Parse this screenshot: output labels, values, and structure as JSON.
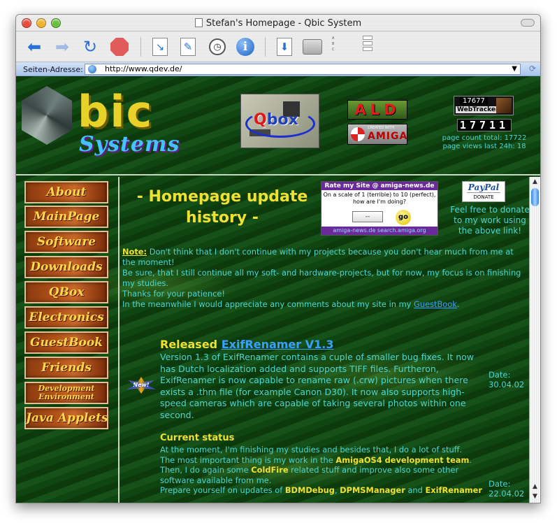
{
  "window": {
    "title": "Stefan's Homepage - Qbic System"
  },
  "address": {
    "label": "Seiten-Adresse:",
    "url": "http://www.qdev.de/"
  },
  "toolbar": {
    "back_icon": "back-arrow-icon",
    "forward_icon": "forward-arrow-icon",
    "reload_icon": "reload-icon",
    "stop_icon": "stop-icon",
    "text_size": [
      "A",
      "B",
      "C"
    ]
  },
  "banner": {
    "logo_main": "bic",
    "logo_sub": "Systems",
    "qbox_label_q": "Q",
    "qbox_label_rest": "box",
    "ald_text": "ALD",
    "amiga_created": "CREATED WITH",
    "amiga_text": "AMIGA",
    "tracker_number": "17677",
    "tracker_label": "WebTracker",
    "counter": "17711",
    "stats_line1": "page count total: 17722",
    "stats_line2": "page views last 24h: 18"
  },
  "nav": {
    "items": [
      "About",
      "MainPage",
      "Software",
      "Downloads",
      "QBox",
      "Electronics",
      "GuestBook",
      "Friends",
      "Development Environment",
      "Java Applets"
    ]
  },
  "content": {
    "title_line1": "- Homepage update",
    "title_line2": "history -",
    "rate": {
      "header": "Rate my Site @ amiga-news.de",
      "question": "On a scale of 1 (terrible) to 10 (perfect), how are I'm doing?",
      "select_value": "--",
      "go": "go",
      "footer": "amiga-news.de  search.amiga.org"
    },
    "paypal": {
      "logo": "PayPal",
      "donate": "DONATE"
    },
    "donate_text": "Feel free to donate to my work using the above link!",
    "note": {
      "label": "Note:",
      "line1": " Don't think that I don't continue with my projects because you don't hear much from me at the moment!",
      "line2": "Be sure, that I still continue all my soft- and hardware-projects, but for now, my focus is on finishing my studies.",
      "line3": "Thanks for your patience!",
      "line4_pre": "In the meanwhile I would appreciate any comments about my site in my ",
      "guestbook": "GuestBook",
      "line4_post": "."
    },
    "new_badge": "New!",
    "release": {
      "prefix": "Released ",
      "link": "ExifRenamer V1.3",
      "body": "Version 1.3 of ExifRenamer contains a cuple of smaller bug fixes. It now has Dutch localization added and supports TIFF files. Furtheron, ExifRenamer is now capable to rename raw (.crw) pictures when there exists a .thm file (for example Canon D30). It now also supports high-speed cameras which are capable of taking several photos within one second.",
      "date_label": "Date:",
      "date": "30.04.02"
    },
    "status": {
      "heading": "Current status",
      "l1": "At the moment, I'm finishing my studies and besides that, I do a lot of stuff.",
      "l2_pre": "The most important thing is my work in the ",
      "l2_b": "AmigaOS4 development team",
      "l2_post": ".",
      "l3_pre": "Then, I do again some ",
      "l3_b": "ColdFire",
      "l3_post": " related stuff and improve also some other software available from me.",
      "l4_pre": "Prepare yourself on updates of ",
      "l4_b1": "BDMDebug",
      "l4_mid1": ", ",
      "l4_b2": "DPMSManager",
      "l4_mid2": " and ",
      "l4_b3": "ExifRenamer",
      "date_label": "Date:",
      "date": "22.04.02"
    }
  }
}
